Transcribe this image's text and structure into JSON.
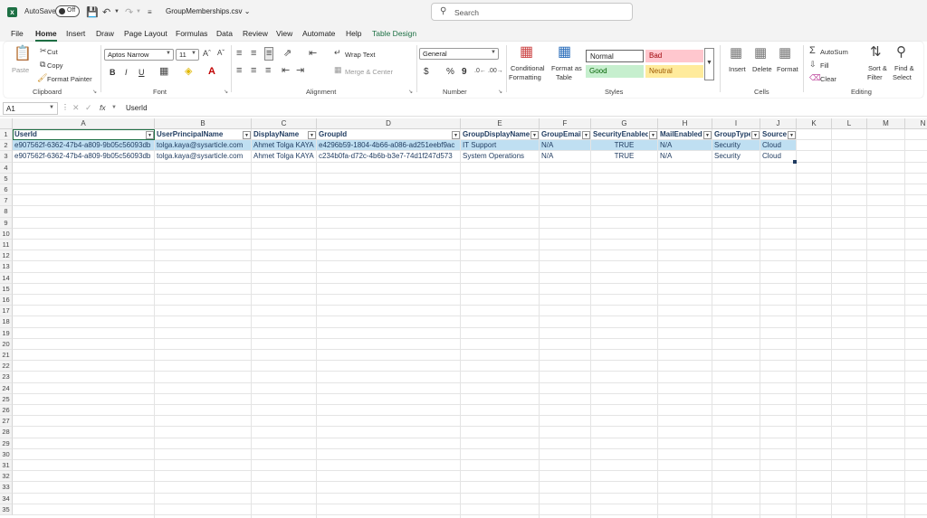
{
  "titlebar": {
    "autosave_label": "AutoSave",
    "autosave_state": "Off",
    "filename": "GroupMemberships.csv",
    "search_placeholder": "Search"
  },
  "menu_tabs": [
    "File",
    "Home",
    "Insert",
    "Draw",
    "Page Layout",
    "Formulas",
    "Data",
    "Review",
    "View",
    "Automate",
    "Help",
    "Table Design"
  ],
  "active_tab": "Home",
  "ribbon": {
    "clipboard": {
      "label": "Clipboard",
      "paste": "Paste",
      "cut": "Cut",
      "copy": "Copy",
      "format_painter": "Format Painter"
    },
    "font": {
      "label": "Font",
      "font_name": "Aptos Narrow",
      "font_size": "11",
      "bold": "B",
      "italic": "I",
      "underline": "U"
    },
    "alignment": {
      "label": "Alignment",
      "wrap_text": "Wrap Text",
      "merge_center": "Merge & Center"
    },
    "number": {
      "label": "Number",
      "format": "General",
      "currency": "$",
      "percent": "%",
      "comma": "9"
    },
    "styles": {
      "label": "Styles",
      "conditional": [
        "Conditional",
        "Formatting"
      ],
      "format_table": [
        "Format as",
        "Table"
      ],
      "normal": "Normal",
      "bad": "Bad",
      "good": "Good",
      "neutral": "Neutral"
    },
    "cells": {
      "label": "Cells",
      "insert": "Insert",
      "delete": "Delete",
      "format": "Format"
    },
    "editing": {
      "label": "Editing",
      "autosum": "AutoSum",
      "fill": "Fill",
      "clear": "Clear",
      "sort_filter": [
        "Sort &",
        "Filter"
      ],
      "find_select": [
        "Find &",
        "Select"
      ]
    }
  },
  "formula_bar": {
    "name_box": "A1",
    "fx": "fx",
    "content": "UserId"
  },
  "columns": [
    "A",
    "B",
    "C",
    "D",
    "E",
    "F",
    "G",
    "H",
    "I",
    "J",
    "K",
    "L",
    "M",
    "N"
  ],
  "table": {
    "headers": [
      "UserId",
      "UserPrincipalName",
      "DisplayName",
      "GroupId",
      "GroupDisplayName",
      "GroupEmail",
      "SecurityEnabled",
      "MailEnabled",
      "GroupType",
      "Source"
    ],
    "rows": [
      [
        "e907562f-6362-47b4-a809-9b05c56093db",
        "tolga.kaya@sysarticle.com",
        "Ahmet Tolga KAYA",
        "e4296b59-1804-4b66-a086-ad251eebf9ac",
        "IT Support",
        "N/A",
        "TRUE",
        "N/A",
        "Security",
        "Cloud"
      ],
      [
        "e907562f-6362-47b4-a809-9b05c56093db",
        "tolga.kaya@sysarticle.com",
        "Ahmet Tolga KAYA",
        "c234b0fa-d72c-4b6b-b3e7-74d1f247d573",
        "System Operations",
        "N/A",
        "TRUE",
        "N/A",
        "Security",
        "Cloud"
      ]
    ]
  },
  "row_numbers": [
    "1",
    "2",
    "3",
    "4",
    "5",
    "6",
    "7",
    "8",
    "9",
    "10",
    "11",
    "12",
    "13",
    "14",
    "15",
    "16",
    "17",
    "18",
    "19",
    "20",
    "21",
    "22",
    "23",
    "24",
    "25",
    "26",
    "27",
    "28",
    "29",
    "30",
    "31",
    "32",
    "33",
    "34",
    "35"
  ],
  "colors": {
    "accent": "#1d7044",
    "band": "#d9ebf7",
    "band_selected": "#bfdff2",
    "header_row": "#ffffff"
  }
}
